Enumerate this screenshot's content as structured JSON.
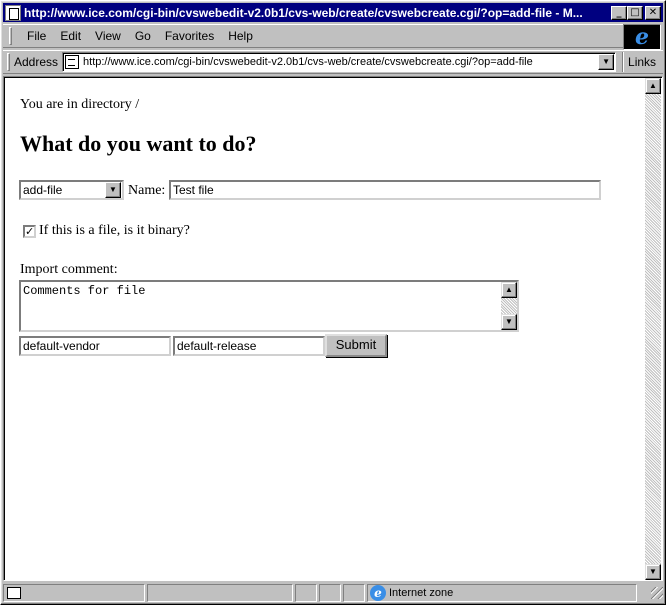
{
  "window": {
    "title": "http://www.ice.com/cgi-bin/cvswebedit-v2.0b1/cvs-web/create/cvswebcreate.cgi/?op=add-file - M...",
    "minimize": "_",
    "maximize": "□",
    "close": "✕"
  },
  "menu": {
    "items": [
      "File",
      "Edit",
      "View",
      "Go",
      "Favorites",
      "Help"
    ]
  },
  "address": {
    "label": "Address",
    "url": "http://www.ice.com/cgi-bin/cvswebedit-v2.0b1/cvs-web/create/cvswebcreate.cgi/?op=add-file",
    "links_label": "Links"
  },
  "page": {
    "directory_text": "You are in directory /",
    "heading": "What do you want to do?",
    "operation_value": "add-file",
    "name_label": "Name:",
    "name_value": "Test file",
    "checkbox_checked": true,
    "checkbox_label": "If this is a file, is it binary?",
    "import_label": "Import comment:",
    "comment_value": "Comments for file",
    "vendor_value": "default-vendor",
    "release_value": "default-release",
    "submit_label": "Submit"
  },
  "status": {
    "zone_text": "Internet zone"
  },
  "icons": {
    "dropdown_arrow": "▼",
    "scroll_up": "▲",
    "scroll_down": "▼",
    "check_mark": "✓",
    "ie_logo": "e"
  }
}
